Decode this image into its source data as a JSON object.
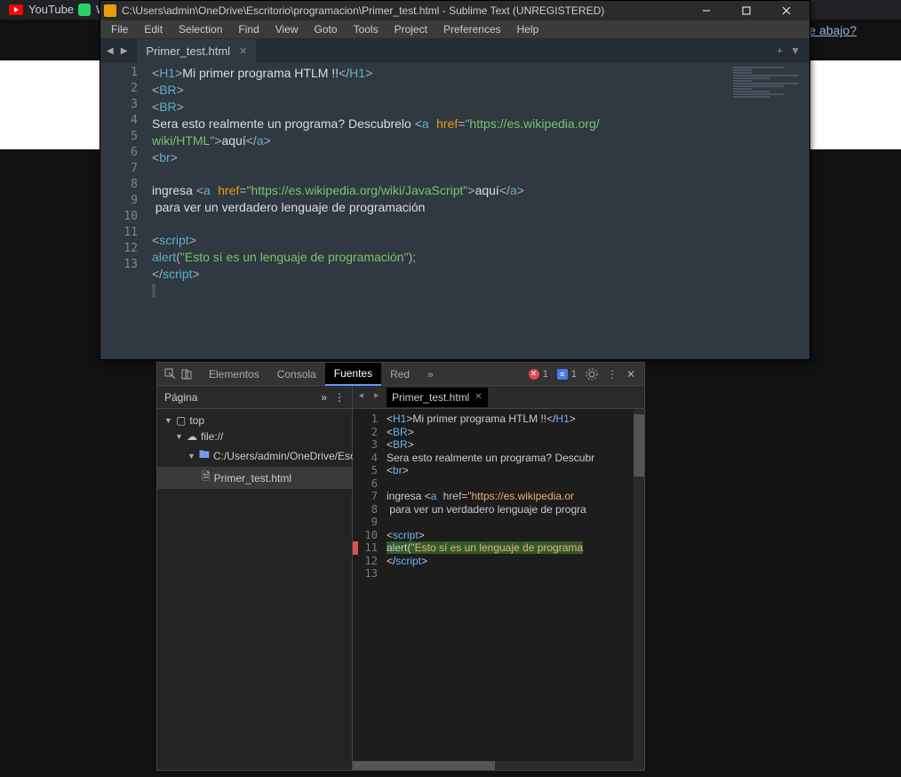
{
  "browser": {
    "tab1": "YouTube",
    "tab2": "W",
    "hint": "e abajo?"
  },
  "sublime": {
    "title": "C:\\Users\\admin\\OneDrive\\Escritorio\\programacion\\Primer_test.html - Sublime Text (UNREGISTERED)",
    "menu": [
      "File",
      "Edit",
      "Selection",
      "Find",
      "View",
      "Goto",
      "Tools",
      "Project",
      "Preferences",
      "Help"
    ],
    "tab": "Primer_test.html",
    "lines": [
      "1",
      "2",
      "3",
      "4",
      "5",
      "6",
      "7",
      "8",
      "9",
      "10",
      "11",
      "12",
      "13"
    ],
    "code": {
      "l1a": "H1",
      "l1t": "Mi primer programa HTLM !!",
      "l1b": "H1",
      "l2": "BR",
      "l3": "BR",
      "l4a": "Sera esto realmente un programa? Descubrelo ",
      "l4b": "a",
      "l4c": "href",
      "l4d": "\"https://es.wikipedia.org/",
      "l4e": "wiki/HTML\"",
      "l4f": "aquí",
      "l4g": "a",
      "l5": "br",
      "l7a": "ingresa ",
      "l7b": "a",
      "l7c": "href",
      "l7d": "\"https://es.wikipedia.org/wiki/JavaScript\"",
      "l7e": "aquí",
      "l7f": "a",
      "l8": " para ver un verdadero lenguaje de programación",
      "l10": "script",
      "l11a": "alert",
      "l11b": "\"Esto sí es un lenguaje de programación\"",
      "l12": "script"
    }
  },
  "devtools": {
    "tabs": {
      "elementos": "Elementos",
      "consola": "Consola",
      "fuentes": "Fuentes",
      "red": "Red"
    },
    "error_count": "1",
    "msg_count": "1",
    "left": {
      "title": "Página",
      "tree": {
        "top": "top",
        "file": "file://",
        "path": "C:/Users/admin/OneDrive/Escri",
        "name": "Primer_test.html"
      }
    },
    "right": {
      "tab": "Primer_test.html",
      "lines": [
        "1",
        "2",
        "3",
        "4",
        "5",
        "6",
        "7",
        "8",
        "9",
        "10",
        "11",
        "12",
        "13"
      ],
      "code": {
        "l1a": "H1",
        "l1t": "Mi primer programa HTLM !!",
        "l1b": "H1",
        "l2": "BR",
        "l3": "BR",
        "l4": "Sera esto realmente un programa? Descubr",
        "l5": "br",
        "l7a": "ingresa ",
        "l7b": "a",
        "l7c": "href",
        "l7d": "\"https://es.wikipedia.or",
        "l8": " para ver un verdadero lenguaje de progra",
        "l10": "script",
        "l11a": "alert",
        "l11b": "\"Esto sí es un lenguaje de programa",
        "l12": "script"
      }
    }
  }
}
